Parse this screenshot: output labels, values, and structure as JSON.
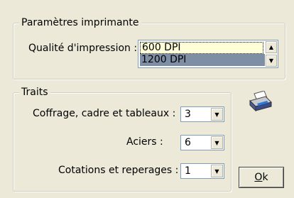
{
  "printer_group": {
    "title": "Paramètres imprimante",
    "quality_label": "Qualité d'impression :",
    "quality_options": [
      "600 DPI",
      "1200 DPI"
    ],
    "quality_selected": "600 DPI"
  },
  "traits_group": {
    "title": "Traits",
    "coffrage_label": "Coffrage, cadre et tableaux :",
    "coffrage_value": "3",
    "aciers_label": "Aciers :",
    "aciers_value": "6",
    "cotations_label": "Cotations et reperages :",
    "cotations_value": "1"
  },
  "ok_button": {
    "accel": "O",
    "rest": "k"
  },
  "icons": {
    "printer": "printer-icon",
    "scroll_up": "scroll-up-icon",
    "scroll_down": "scroll-down-icon",
    "dropdown": "chevron-down-icon"
  },
  "colors": {
    "background": "#ece9d8",
    "selected_item_bg": "#7e8fa5",
    "field_border": "#7f9db9"
  }
}
